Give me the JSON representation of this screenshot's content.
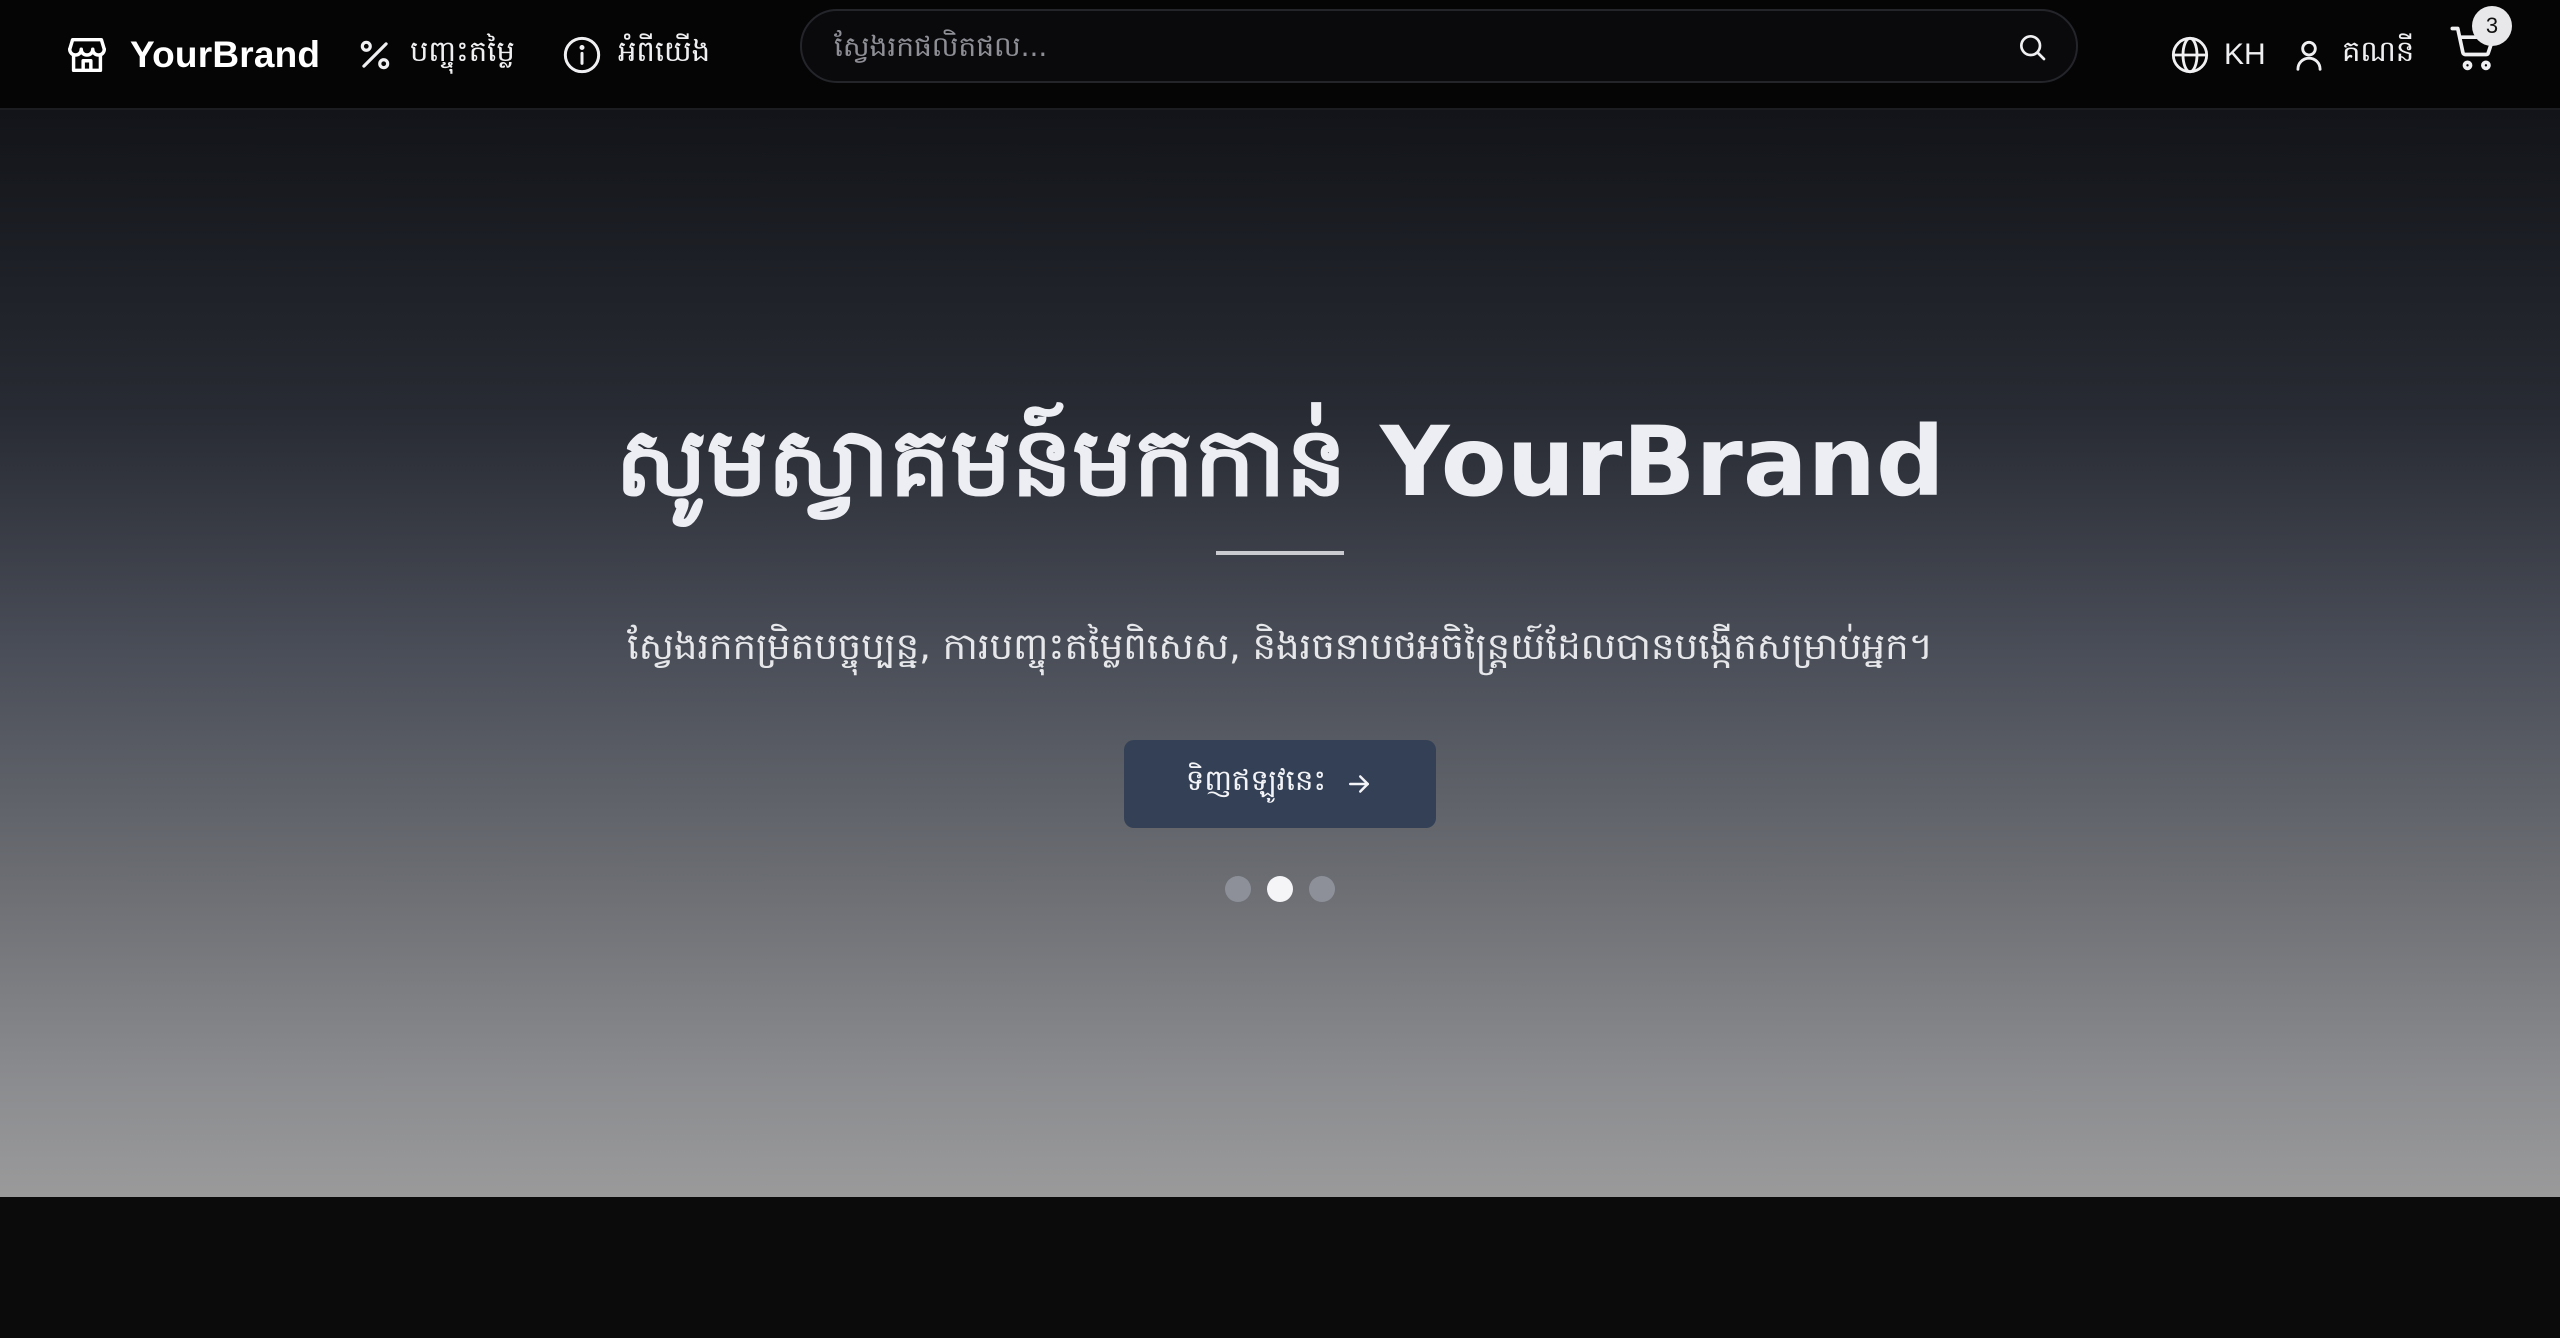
{
  "header": {
    "brand": {
      "name": "YourBrand",
      "icon": "store-icon"
    },
    "nav": [
      {
        "label": "បញ្ចុះតម្លៃ",
        "icon": "percent-icon"
      },
      {
        "label": "អំពីយើង",
        "icon": "info-icon"
      }
    ],
    "search": {
      "placeholder": "ស្វែងរកផលិតផល...",
      "value": "",
      "icon": "search-icon"
    },
    "language": {
      "label": "KH",
      "icon": "globe-icon"
    },
    "account": {
      "label": "គណនី",
      "icon": "user-icon"
    },
    "cart": {
      "count": "3",
      "icon": "cart-icon"
    }
  },
  "hero": {
    "title": "សូមស្វាគមន៍មកកាន់ YourBrand",
    "subtitle": "ស្វែងរកកម្រិតបច្ចុប្បន្ន, ការបញ្ចុះតម្លៃពិសេស, និងរចនាបថអចិន្ត្រៃយ៍ដែលបានបង្កើតសម្រាប់អ្នក។",
    "cta_label": "ទិញឥឡូវនេះ",
    "cta_icon": "arrow-right-icon",
    "slides": {
      "count": 3,
      "active_index": 1
    }
  },
  "colors": {
    "header_bg": "#050506",
    "button_bg": "#334055",
    "hero_top": "#121419",
    "hero_bottom": "#9a9a9b"
  }
}
